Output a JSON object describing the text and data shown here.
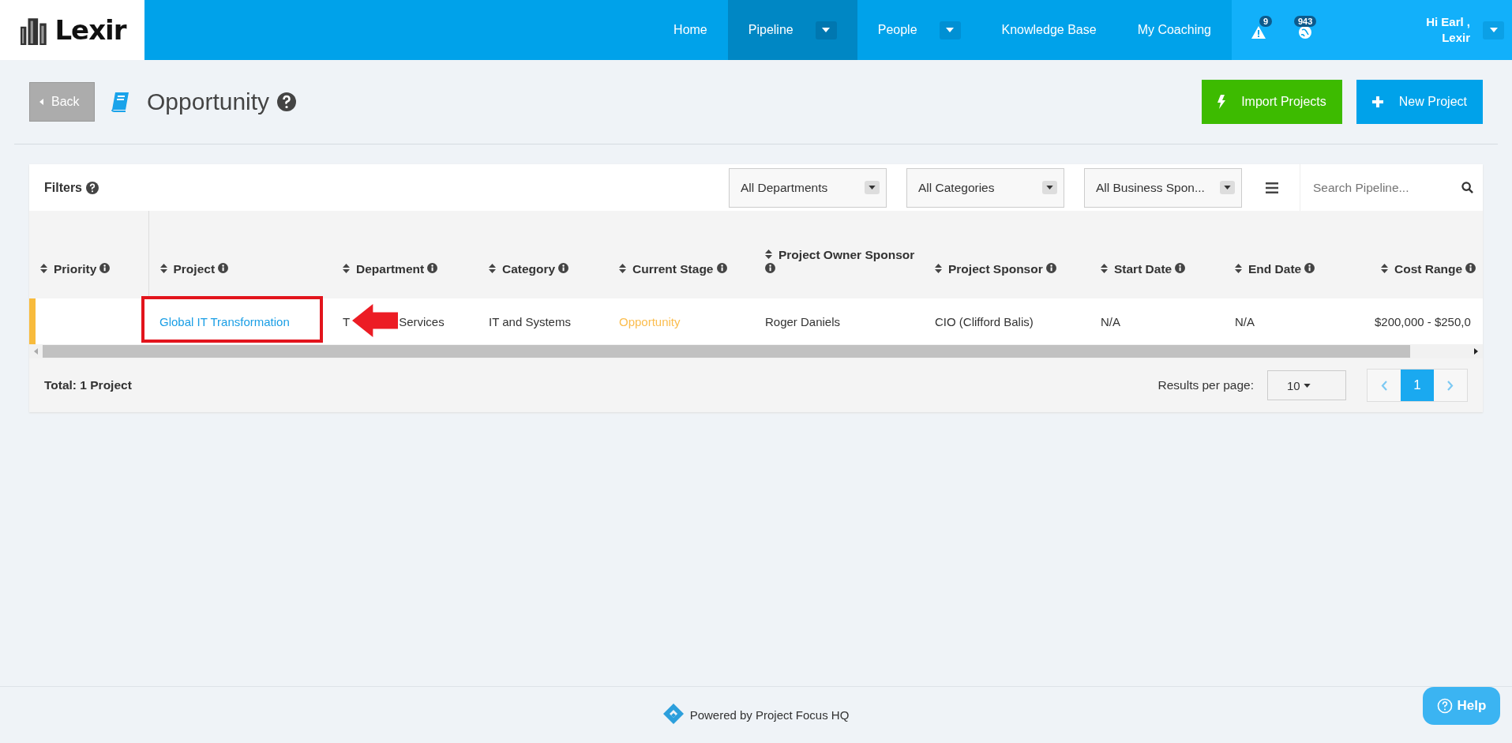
{
  "logo": {
    "text": "Lexir"
  },
  "nav": [
    {
      "label": "Home",
      "selected": false,
      "dropdown": false
    },
    {
      "label": "Pipeline",
      "selected": true,
      "dropdown": true
    },
    {
      "label": "People",
      "selected": false,
      "dropdown": true
    },
    {
      "label": "Knowledge Base",
      "selected": false,
      "dropdown": false
    },
    {
      "label": "My Coaching",
      "selected": false,
      "dropdown": false
    }
  ],
  "notifications": [
    {
      "kind": "alert",
      "count": "9"
    },
    {
      "kind": "globe",
      "count": "943"
    }
  ],
  "user": {
    "greeting": "Hi Earl ,",
    "org": "Lexir"
  },
  "page": {
    "back": "Back",
    "title": "Opportunity"
  },
  "actions": [
    {
      "kind": "import",
      "label": "Import Projects"
    },
    {
      "kind": "new",
      "label": "New Project"
    }
  ],
  "filters": {
    "label": "Filters",
    "dropdowns": [
      "All Departments",
      "All Categories",
      "All Business Spon..."
    ],
    "search_placeholder": "Search Pipeline..."
  },
  "table": {
    "columns": [
      "Priority",
      "Project",
      "Department",
      "Category",
      "Current Stage",
      "Project Owner Sponsor",
      "Project Sponsor",
      "Start Date",
      "End Date",
      "Cost Range"
    ],
    "rows": [
      {
        "priority": {
          "color": "#f8bb3c"
        },
        "project": "Global IT Transformation",
        "department": [
          "T",
          "Services"
        ],
        "category": "IT and Systems",
        "stage": "Opportunity",
        "owner_sponsor": "Roger Daniels",
        "sponsor": "CIO (Clifford Balis)",
        "start": "N/A",
        "end": "N/A",
        "cost": "$200,000 - $250,0"
      }
    ]
  },
  "total": "Total: 1 Project",
  "pagination": {
    "results_label": "Results per page:",
    "per_page": "10",
    "pages": [
      {
        "label": "1",
        "selected": true
      }
    ]
  },
  "footer": {
    "text": "Powered by Project Focus HQ"
  },
  "help": "Help"
}
